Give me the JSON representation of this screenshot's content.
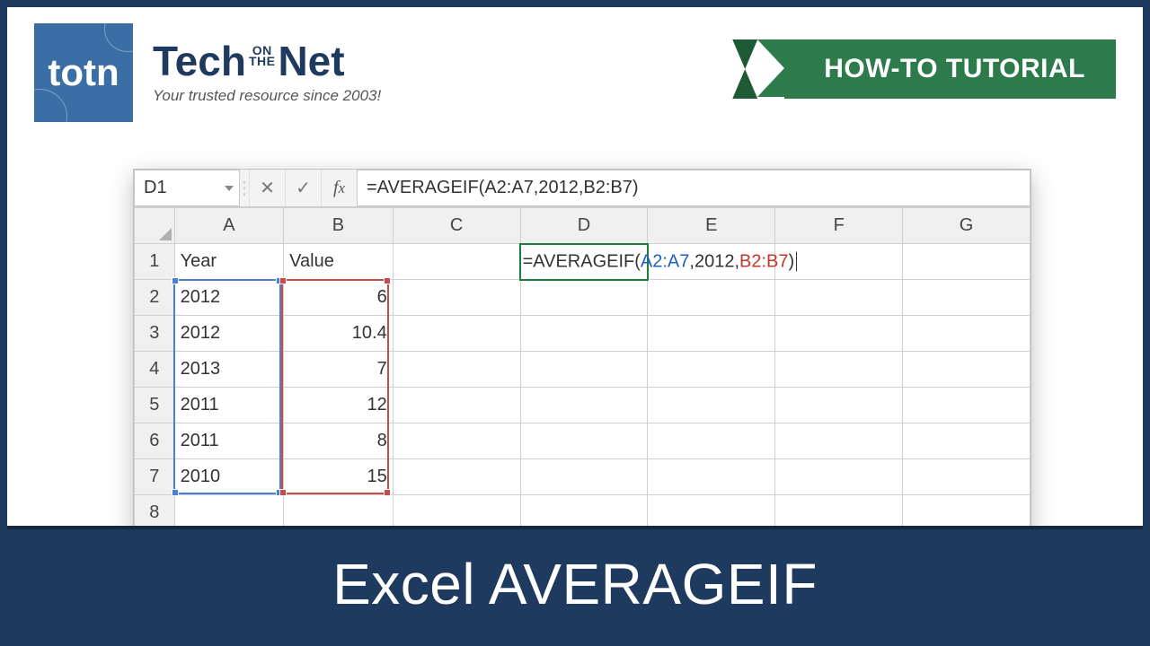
{
  "logo": {
    "short": "totn"
  },
  "brand": {
    "word1": "Tech",
    "mid_top": "ON",
    "mid_bot": "THE",
    "word2": "Net",
    "tagline": "Your trusted resource since 2003!"
  },
  "ribbon": {
    "label": "HOW-TO TUTORIAL"
  },
  "excel": {
    "namebox": "D1",
    "formula_bar": "=AVERAGEIF(A2:A7,2012,B2:B7)",
    "columns": [
      "A",
      "B",
      "C",
      "D",
      "E",
      "F",
      "G"
    ],
    "rows": [
      "1",
      "2",
      "3",
      "4",
      "5",
      "6",
      "7",
      "8"
    ],
    "headers": {
      "A1": "Year",
      "B1": "Value"
    },
    "data": [
      {
        "year": "2012",
        "value": "6"
      },
      {
        "year": "2012",
        "value": "10.4"
      },
      {
        "year": "2013",
        "value": "7"
      },
      {
        "year": "2011",
        "value": "12"
      },
      {
        "year": "2011",
        "value": "8"
      },
      {
        "year": "2010",
        "value": "15"
      }
    ],
    "cell_formula": {
      "eq": "=AVERAGEIF(",
      "ref1": "A2:A7",
      "comma1": ",",
      "crit": "2012",
      "comma2": ",",
      "ref2": "B2:B7",
      "close": ")"
    }
  },
  "bottom_title": "Excel AVERAGEIF"
}
